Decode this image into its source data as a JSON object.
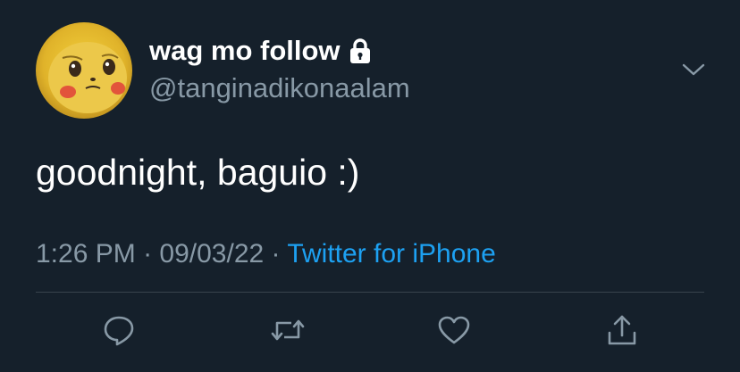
{
  "tweet": {
    "display_name": "wag mo follow",
    "handle": "@tanginadikonaalam",
    "text": "goodnight, baguio :)",
    "time": "1:26 PM",
    "date": "09/03/22",
    "separator": "·",
    "source": "Twitter for iPhone",
    "protected_icon": "lock-icon",
    "avatar": "pikachu-avatar"
  },
  "actions": [
    {
      "name": "reply",
      "icon": "reply-icon"
    },
    {
      "name": "retweet",
      "icon": "retweet-icon"
    },
    {
      "name": "like",
      "icon": "heart-icon"
    },
    {
      "name": "share",
      "icon": "share-icon"
    }
  ],
  "colors": {
    "background": "#15202b",
    "primary_text": "#ffffff",
    "secondary_text": "#8899a6",
    "link": "#1da1f2",
    "divider": "#38444d"
  }
}
